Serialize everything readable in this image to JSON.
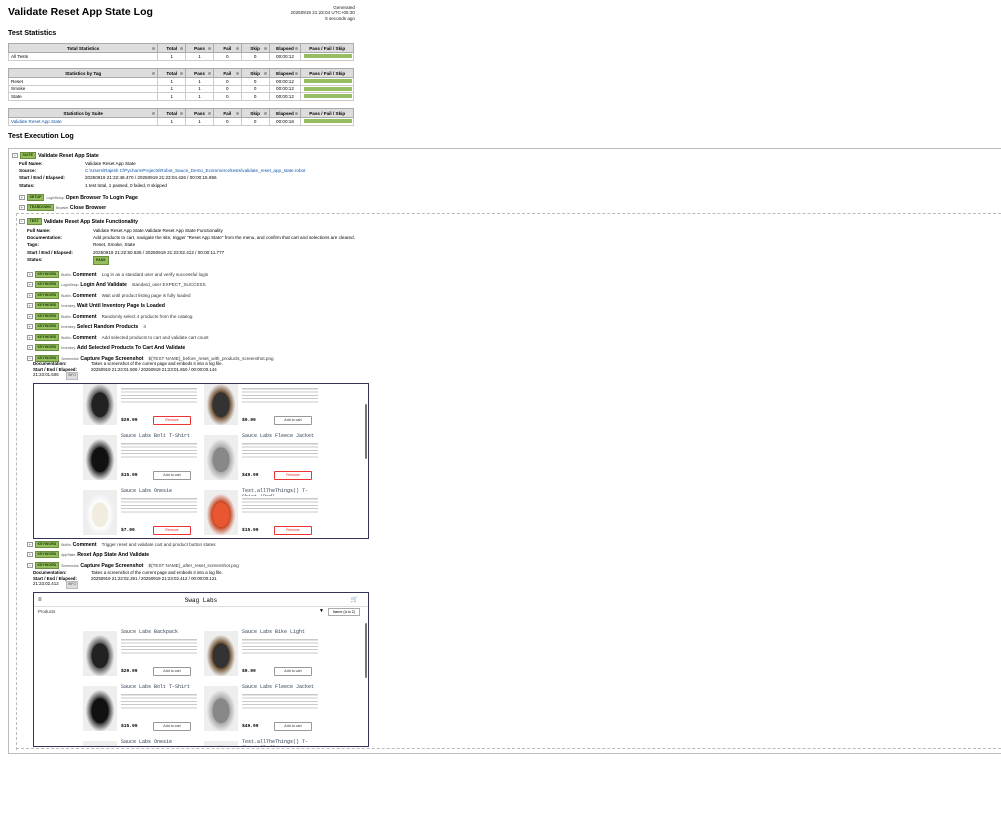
{
  "header": {
    "title": "Validate Reset App State Log",
    "generated_label": "Generated",
    "generated_time": "20250919 21:23:04 UTC+05:30",
    "generated_ago": "5 seconds ago"
  },
  "statistics": {
    "title": "Test Statistics",
    "columns": [
      "Total",
      "Pass",
      "Fail",
      "Skip",
      "Elapsed",
      "Pass / Fail / Skip"
    ],
    "total": {
      "header": "Total Statistics",
      "rows": [
        {
          "name": "All Tests",
          "total": "1",
          "pass": "1",
          "fail": "0",
          "skip": "0",
          "elapsed": "00:00:12",
          "pass_ratio": 1.0
        }
      ]
    },
    "tag": {
      "header": "Statistics by Tag",
      "rows": [
        {
          "name": "Reset",
          "total": "1",
          "pass": "1",
          "fail": "0",
          "skip": "0",
          "elapsed": "00:00:12",
          "pass_ratio": 1.0
        },
        {
          "name": "Smoke",
          "total": "1",
          "pass": "1",
          "fail": "0",
          "skip": "0",
          "elapsed": "00:00:12",
          "pass_ratio": 1.0
        },
        {
          "name": "State",
          "total": "1",
          "pass": "1",
          "fail": "0",
          "skip": "0",
          "elapsed": "00:00:12",
          "pass_ratio": 1.0
        }
      ]
    },
    "suite": {
      "header": "Statistics by Suite",
      "rows": [
        {
          "name": "Validate Reset App State",
          "total": "1",
          "pass": "1",
          "fail": "0",
          "skip": "0",
          "elapsed": "00:00:16",
          "pass_ratio": 1.0
        }
      ]
    }
  },
  "log": {
    "title": "Test Execution Log",
    "suite": {
      "badge": "SUITE",
      "name": "Validate Reset App State",
      "labels": {
        "full_name": "Full Name:",
        "source": "Source:",
        "times": "Start / End / Elapsed:",
        "status": "Status:"
      },
      "full_name": "Validate Reset App State",
      "source": "C:\\Users\\Rajesh C\\PycharmProjects\\Robot_Sauce_Demo_Ecommerce\\tests\\validate_reset_app_state.robot",
      "times": "20250919 21:22:48.470 / 20250919 21:23:04.426 / 00:00:15.956",
      "status": "1 test total, 1 passed, 0 failed, 0 skipped"
    },
    "setup": {
      "badge": "SETUP",
      "owner": "LoginSetup.",
      "name": "Open Browser To Login Page"
    },
    "teardown": {
      "badge": "TEARDOWN",
      "owner": "Browser.",
      "name": "Close Browser"
    },
    "test": {
      "badge": "TEST",
      "name": "Validate Reset App State Functionality",
      "labels": {
        "full_name": "Full Name:",
        "doc": "Documentation:",
        "tags": "Tags:",
        "times": "Start / End / Elapsed:",
        "status": "Status:"
      },
      "full_name": "Validate Reset App State.Validate Reset App State Functionality",
      "doc": "Add products to cart, navigate the site, trigger \"Reset App State\" from the menu, and confirm that cart and selections are cleared.",
      "tags": "Reset, Smoke, State",
      "times": "20250919 21:22:50.635 / 20250919 21:23:02.412 / 00:00:11.777",
      "status": "PASS"
    },
    "keywords": [
      {
        "badge": "KEYWORD",
        "owner": "BuiltIn.",
        "name": "Comment",
        "args": "Log in as a standard user and verify successful login"
      },
      {
        "badge": "KEYWORD",
        "owner": "LoginSetup.",
        "name": "Login And Validate",
        "args": "standard_user    EXPECT_SUCCESS"
      },
      {
        "badge": "KEYWORD",
        "owner": "BuiltIn.",
        "name": "Comment",
        "args": "Wait until product listing page is fully loaded"
      },
      {
        "badge": "KEYWORD",
        "owner": "Inventory.",
        "name": "Wait Until Inventory Page Is Loaded",
        "args": ""
      },
      {
        "badge": "KEYWORD",
        "owner": "BuiltIn.",
        "name": "Comment",
        "args": "Randomly select 4 products from the catalog"
      },
      {
        "badge": "KEYWORD",
        "owner": "Inventory.",
        "name": "Select Random Products",
        "args": "4"
      },
      {
        "badge": "KEYWORD",
        "owner": "BuiltIn.",
        "name": "Comment",
        "args": "Add selected products to cart and validate cart count"
      },
      {
        "badge": "KEYWORD",
        "owner": "Inventory.",
        "name": "Add Selected Products To Cart And Validate",
        "args": ""
      },
      {
        "badge": "KEYWORD",
        "owner": "Screenshot.",
        "name": "Capture Page Screenshot",
        "args": "${TEST NAME}_before_reset_with_products_screenshot.png"
      }
    ],
    "shot1": {
      "doc_label": "Documentation:",
      "doc": "Takes a screenshot of the current page and embeds it into a log file.",
      "times_label": "Start / End / Elapsed:",
      "times": "20250919 21:23:01.506 / 20250919 21:23:01.650 / 00:00:00.144",
      "timestamp": "21:23:01.506",
      "level": "INFO"
    },
    "keywords2": [
      {
        "badge": "KEYWORD",
        "owner": "BuiltIn.",
        "name": "Comment",
        "args": "Trigger reset and validate cart and product button states"
      },
      {
        "badge": "KEYWORD",
        "owner": "AppState.",
        "name": "Reset App State And Validate",
        "args": ""
      },
      {
        "badge": "KEYWORD",
        "owner": "Screenshot.",
        "name": "Capture Page Screenshot",
        "args": "${TEST NAME}_after_reset_screenshot.png"
      }
    ],
    "shot2": {
      "doc_label": "Documentation:",
      "doc": "Takes a screenshot of the current page and embeds it into a log file.",
      "times_label": "Start / End / Elapsed:",
      "times": "20250919 21:23:02.291 / 20250919 21:23:02.412 / 00:00:00.121",
      "timestamp": "21:23:02.412",
      "level": "INFO"
    }
  },
  "screens": {
    "shot1_products": [
      {
        "name": "Sauce Labs Backpack",
        "price": "$29.99",
        "button": "Remove"
      },
      {
        "name": "Sauce Labs Bike Light",
        "price": "$9.99",
        "button": "Add to cart"
      },
      {
        "name": "Sauce Labs Bolt T-Shirt",
        "price": "$15.99",
        "button": "Add to cart"
      },
      {
        "name": "Sauce Labs Fleece Jacket",
        "price": "$49.99",
        "button": "Remove"
      },
      {
        "name": "Sauce Labs Onesie",
        "price": "$7.99",
        "button": "Remove"
      },
      {
        "name": "Test.allTheThings() T-Shirt (Red)",
        "price": "$15.99",
        "button": "Remove"
      }
    ],
    "shot2_header": {
      "app_title": "Swag Labs",
      "section": "Products",
      "sort": "Name (A to Z)"
    },
    "shot2_products": [
      {
        "name": "Sauce Labs Backpack",
        "price": "$29.99",
        "button": "Add to cart"
      },
      {
        "name": "Sauce Labs Bike Light",
        "price": "$9.99",
        "button": "Add to cart"
      },
      {
        "name": "Sauce Labs Bolt T-Shirt",
        "price": "$15.99",
        "button": "Add to cart"
      },
      {
        "name": "Sauce Labs Fleece Jacket",
        "price": "$49.99",
        "button": "Add to cart"
      },
      {
        "name": "Sauce Labs Onesie",
        "price": "",
        "button": ""
      },
      {
        "name": "Test.allTheThings() T-Shirt (Red)",
        "price": "",
        "button": ""
      }
    ]
  }
}
